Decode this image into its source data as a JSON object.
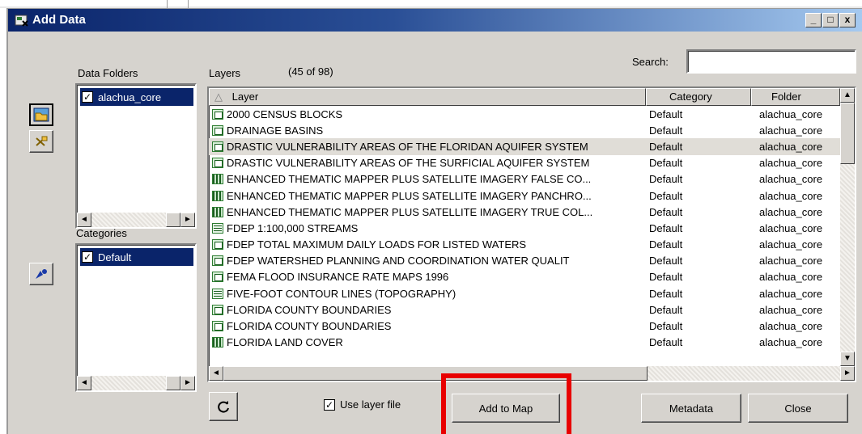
{
  "window": {
    "title": "Add Data",
    "minimize": "_",
    "maximize": "□",
    "close": "x"
  },
  "labels": {
    "data_folders": "Data Folders",
    "layers": "Layers",
    "layer_count": "(45 of 98)",
    "search": "Search:",
    "categories": "Categories"
  },
  "search": {
    "value": ""
  },
  "folders": [
    {
      "label": "alachua_core",
      "checked": true
    }
  ],
  "categories": [
    {
      "label": "Default",
      "checked": true
    }
  ],
  "table": {
    "columns": [
      "Layer",
      "Category",
      "Folder"
    ],
    "rows": [
      {
        "icon": "vector-layer-icon",
        "layer": "2000 CENSUS BLOCKS",
        "category": "Default",
        "folder": "alachua_core"
      },
      {
        "icon": "vector-layer-icon",
        "layer": "DRAINAGE BASINS",
        "category": "Default",
        "folder": "alachua_core"
      },
      {
        "icon": "vector-layer-icon",
        "layer": "DRASTIC VULNERABILITY AREAS OF THE FLORIDAN AQUIFER SYSTEM",
        "category": "Default",
        "folder": "alachua_core",
        "selected": true
      },
      {
        "icon": "vector-layer-icon",
        "layer": "DRASTIC VULNERABILITY AREAS OF THE SURFICIAL AQUIFER SYSTEM",
        "category": "Default",
        "folder": "alachua_core"
      },
      {
        "icon": "image-layer-icon",
        "layer": "ENHANCED THEMATIC MAPPER PLUS SATELLITE IMAGERY FALSE CO...",
        "category": "Default",
        "folder": "alachua_core"
      },
      {
        "icon": "image-layer-icon",
        "layer": "ENHANCED THEMATIC MAPPER PLUS SATELLITE IMAGERY PANCHRO...",
        "category": "Default",
        "folder": "alachua_core"
      },
      {
        "icon": "image-layer-icon",
        "layer": "ENHANCED THEMATIC MAPPER PLUS SATELLITE IMAGERY TRUE COL...",
        "category": "Default",
        "folder": "alachua_core"
      },
      {
        "icon": "line-layer-icon",
        "layer": "FDEP 1:100,000 STREAMS",
        "category": "Default",
        "folder": "alachua_core"
      },
      {
        "icon": "vector-layer-icon",
        "layer": "FDEP TOTAL MAXIMUM DAILY LOADS FOR LISTED WATERS",
        "category": "Default",
        "folder": "alachua_core"
      },
      {
        "icon": "vector-layer-icon",
        "layer": "FDEP WATERSHED PLANNING AND COORDINATION WATER QUALIT",
        "category": "Default",
        "folder": "alachua_core"
      },
      {
        "icon": "vector-layer-icon",
        "layer": "FEMA FLOOD INSURANCE RATE MAPS 1996",
        "category": "Default",
        "folder": "alachua_core"
      },
      {
        "icon": "line-layer-icon",
        "layer": "FIVE-FOOT CONTOUR LINES (TOPOGRAPHY)",
        "category": "Default",
        "folder": "alachua_core"
      },
      {
        "icon": "vector-layer-icon",
        "layer": "FLORIDA COUNTY BOUNDARIES",
        "category": "Default",
        "folder": "alachua_core"
      },
      {
        "icon": "vector-layer-icon",
        "layer": "FLORIDA COUNTY BOUNDARIES",
        "category": "Default",
        "folder": "alachua_core"
      },
      {
        "icon": "image-layer-icon",
        "layer": "FLORIDA LAND COVER",
        "category": "Default",
        "folder": "alachua_core"
      }
    ]
  },
  "footer": {
    "use_layer_file_label": "Use layer file",
    "use_layer_file_checked": true,
    "add_to_map": "Add to Map",
    "metadata": "Metadata",
    "close": "Close"
  },
  "arrows": {
    "up": "▲",
    "down": "▼",
    "left": "◄",
    "right": "►",
    "sort": "△"
  },
  "colors": {
    "title_start": "#0a246a",
    "title_end": "#a6caf0",
    "selection": "#0a246a",
    "highlight": "#e80000"
  }
}
